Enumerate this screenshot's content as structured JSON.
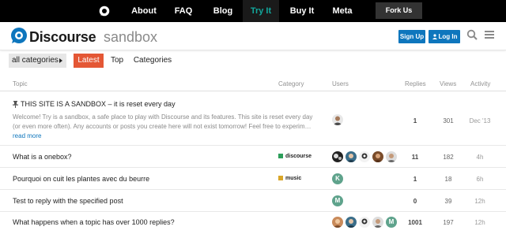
{
  "topnav": {
    "logo_icon": "discourse-bubble-icon",
    "links": [
      "About",
      "FAQ",
      "Blog",
      "Try It",
      "Buy It",
      "Meta"
    ],
    "active": "Try It",
    "fork_label": "Fork Us"
  },
  "header": {
    "brand": "Discourse",
    "brand_sub": "sandbox",
    "signup_label": "Sign Up",
    "login_label": "Log In",
    "search_icon": "search-icon",
    "menu_icon": "hamburger-icon"
  },
  "catbar": {
    "dropdown_label": "all categories",
    "tabs": [
      "Latest",
      "Top",
      "Categories"
    ]
  },
  "columns": {
    "topic": "Topic",
    "category": "Category",
    "users": "Users",
    "replies": "Replies",
    "views": "Views",
    "activity": "Activity"
  },
  "rows": [
    {
      "title": "THIS SITE IS A SANDBOX – it is reset every day",
      "pinned": true,
      "excerpt": "Welcome! Try is a sandbox, a safe place to play with Discourse and its features. This site is reset every day (or even more often). Any accounts or posts you create here will not exist tomorrow! Feel free to experim…",
      "read_more": "read more",
      "category": "",
      "replies": "1",
      "views": "301",
      "activity": "Dec '13"
    },
    {
      "title": "What is a onebox?",
      "category": "discourse",
      "category_color": "#2d9e5a",
      "replies": "11",
      "views": "182",
      "activity": "4h"
    },
    {
      "title": "Pourquoi on cuit les plantes avec du beurre",
      "category": "music",
      "category_color": "#d9a628",
      "avatar_letter": "K",
      "replies": "1",
      "views": "18",
      "activity": "6h"
    },
    {
      "title": "Test to reply with the specified post",
      "category": "",
      "avatar_letter": "M",
      "replies": "0",
      "views": "39",
      "activity": "12h"
    },
    {
      "title": "What happens when a topic has over 1000 replies?",
      "category": "",
      "avatar_letter": "M",
      "replies": "1001",
      "views": "197",
      "activity": "12h"
    }
  ],
  "colors": {
    "nav_active": "#12a89d",
    "brand_blue": "#0e76bd",
    "latest_tab": "#e45735",
    "avatar_green": "#5fa38c"
  }
}
